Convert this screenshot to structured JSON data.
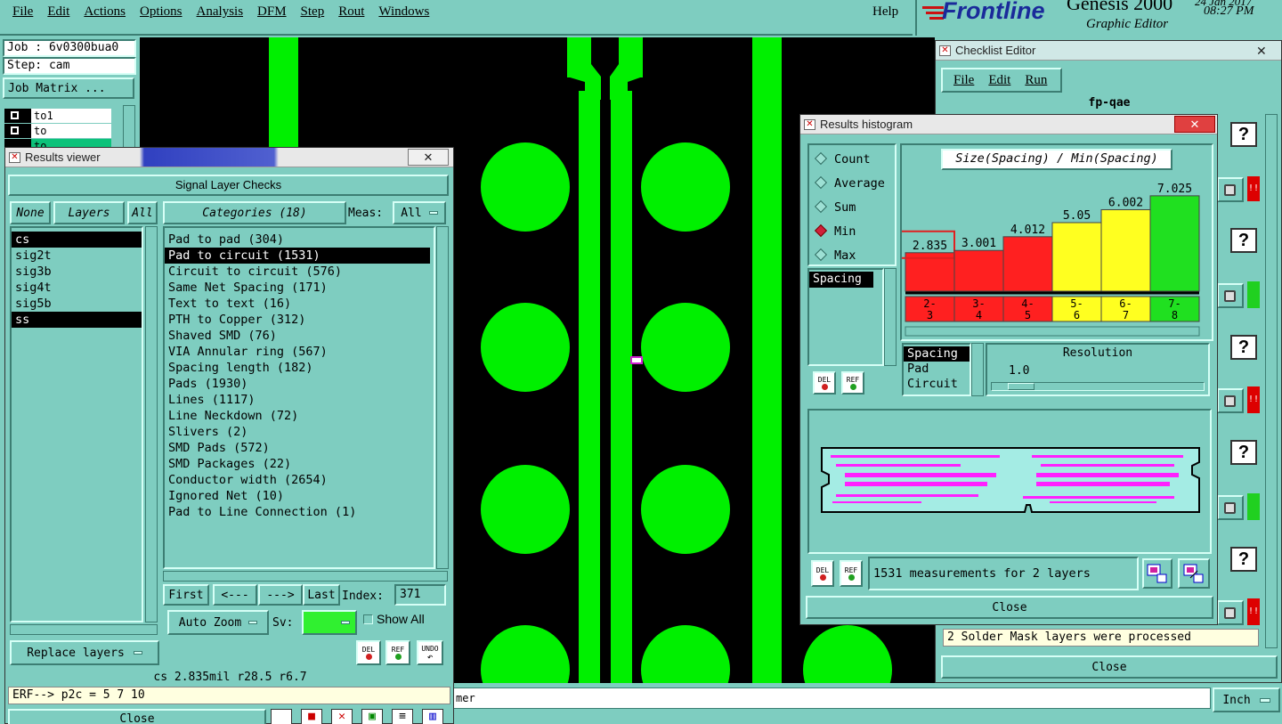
{
  "menu": [
    "File",
    "Edit",
    "Actions",
    "Options",
    "Analysis",
    "DFM",
    "Step",
    "Rout",
    "Windows"
  ],
  "help": "Help",
  "brand": {
    "logo": "Frontline",
    "product": "Genesis 2000",
    "subtitle": "Graphic Editor",
    "date": "24 Jan 2017",
    "time": "08:27 PM"
  },
  "job": {
    "job": "Job : 6v0300bua0",
    "step": "Step: cam",
    "matrix": "Job Matrix ..."
  },
  "layer_strip": [
    "to1",
    "to",
    "to"
  ],
  "results_viewer": {
    "title": "Results viewer",
    "header": "Signal Layer Checks",
    "none": "None",
    "layers": "Layers",
    "all": "All",
    "categories": "Categories (18)",
    "meas_label": "Meas:",
    "meas_value": "All",
    "layer_list": [
      "cs",
      "sig2t",
      "sig3b",
      "sig4t",
      "sig5b",
      "ss"
    ],
    "category_list": [
      "Pad to pad (304)",
      "Pad to circuit (1531)",
      "Circuit to circuit (576)",
      "Same Net Spacing (171)",
      "Text to text (16)",
      "PTH to Copper (312)",
      "Shaved SMD (76)",
      "VIA Annular ring (567)",
      "Spacing length (182)",
      "Pads (1930)",
      "Lines (1117)",
      "Line Neckdown (72)",
      "Slivers (2)",
      "SMD Pads (572)",
      "SMD Packages (22)",
      "Conductor width (2654)",
      "Ignored Net (10)",
      "Pad to Line Connection (1)"
    ],
    "first": "First",
    "prev": "<---",
    "next": "--->",
    "last": "Last",
    "index_label": "Index:",
    "index_value": "371",
    "auto_zoom": "Auto Zoom",
    "sv": "Sv:",
    "show_all": "Show All",
    "replace_layers": "Replace layers",
    "del": "DEL",
    "ref": "REF",
    "undo": "UNDO",
    "status": "cs 2.835mil  r28.5  r6.7",
    "erf": "ERF--> p2c = 5 7 10",
    "close": "Close"
  },
  "bottom_status": "mer",
  "histogram": {
    "title": "Results histogram",
    "modes": [
      "Count",
      "Average",
      "Sum",
      "Min",
      "Max"
    ],
    "selected_mode": "Min",
    "chart_title": "Size(Spacing) / Min(Spacing)",
    "list_sel": "Spacing",
    "del": "DEL",
    "ref": "REF",
    "sort_list": [
      "Spacing",
      "Pad",
      "Circuit"
    ],
    "resolution_label": "Resolution",
    "resolution_value": "1.0",
    "summary": "1531 measurements for 2 layers",
    "close": "Close"
  },
  "chart_data": {
    "type": "bar",
    "title": "Size(Spacing) / Min(Spacing)",
    "categories": [
      "2-3",
      "3-4",
      "4-5",
      "5-6",
      "6-7",
      "7-8"
    ],
    "values": [
      2.835,
      3.001,
      4.012,
      5.05,
      6.002,
      7.025
    ],
    "bar_colors": [
      "#ff2020",
      "#ff2020",
      "#ff2020",
      "#ffff20",
      "#ffff20",
      "#20e020"
    ],
    "highlight": "2-3"
  },
  "checklist": {
    "title": "Checklist Editor",
    "menu": [
      "File",
      "Edit",
      "Run"
    ],
    "name": "fp-qae",
    "message": "2 Solder Mask layers were processed",
    "close": "Close"
  },
  "units": "Inch",
  "colors": {
    "panel": "#7ecdc0",
    "copper": "#00f000",
    "error": "#ff2020",
    "warning": "#ffff20",
    "ok": "#20e020"
  }
}
